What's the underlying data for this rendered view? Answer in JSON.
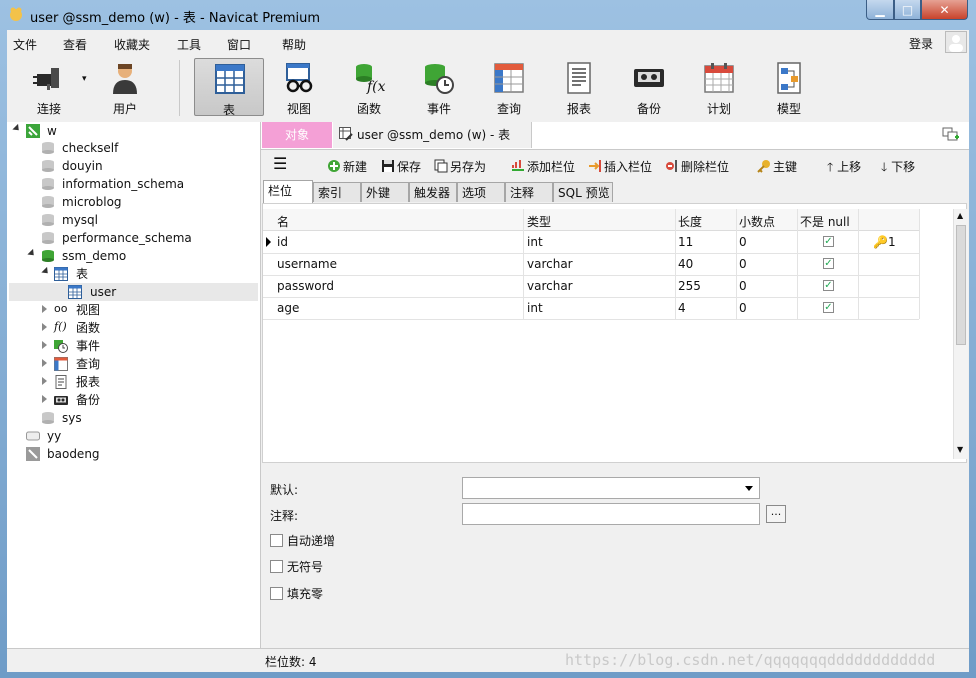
{
  "window": {
    "title": "user @ssm_demo (w) - 表 - Navicat Premium"
  },
  "menu": {
    "items": [
      "文件",
      "查看",
      "收藏夹",
      "工具",
      "窗口",
      "帮助"
    ],
    "login": "登录"
  },
  "toolbar": {
    "items": [
      {
        "label": "连接",
        "icon": "plug-icon"
      },
      {
        "label": "用户",
        "icon": "user-icon"
      },
      {
        "label": "表",
        "icon": "table-icon"
      },
      {
        "label": "视图",
        "icon": "view-glasses-icon"
      },
      {
        "label": "函数",
        "icon": "function-icon"
      },
      {
        "label": "事件",
        "icon": "event-clock-icon"
      },
      {
        "label": "查询",
        "icon": "query-icon"
      },
      {
        "label": "报表",
        "icon": "report-icon"
      },
      {
        "label": "备份",
        "icon": "backup-tape-icon"
      },
      {
        "label": "计划",
        "icon": "calendar-icon"
      },
      {
        "label": "模型",
        "icon": "model-icon"
      }
    ]
  },
  "nav": {
    "connection": "w",
    "databases": [
      "checkself",
      "douyin",
      "information_schema",
      "microblog",
      "mysql",
      "performance_schema",
      "ssm_demo"
    ],
    "ssm_demo": {
      "tables_label": "表",
      "table_user": "user",
      "others": [
        "视图",
        "函数",
        "事件",
        "查询",
        "报表",
        "备份"
      ]
    },
    "sys": "sys",
    "other_connections": [
      "yy",
      "baodeng"
    ]
  },
  "tabs": {
    "object": "对象",
    "doc": "user @ssm_demo (w) - 表"
  },
  "actions": {
    "new": "新建",
    "save": "保存",
    "save_as": "另存为",
    "add_field": "添加栏位",
    "insert_field": "插入栏位",
    "delete_field": "删除栏位",
    "primary_key": "主键",
    "move_up": "上移",
    "move_down": "下移"
  },
  "subtabs": [
    "栏位",
    "索引",
    "外键",
    "触发器",
    "选项",
    "注释",
    "SQL 预览"
  ],
  "grid": {
    "columns": [
      "名",
      "类型",
      "长度",
      "小数点",
      "不是 null"
    ],
    "rows": [
      {
        "name": "id",
        "type": "int",
        "length": "11",
        "decimals": "0",
        "not_null": true,
        "key": "1"
      },
      {
        "name": "username",
        "type": "varchar",
        "length": "40",
        "decimals": "0",
        "not_null": true,
        "key": ""
      },
      {
        "name": "password",
        "type": "varchar",
        "length": "255",
        "decimals": "0",
        "not_null": true,
        "key": ""
      },
      {
        "name": "age",
        "type": "int",
        "length": "4",
        "decimals": "0",
        "not_null": true,
        "key": ""
      }
    ]
  },
  "props": {
    "default_label": "默认:",
    "comment_label": "注释:",
    "ellipsis": "...",
    "checks": [
      "自动递增",
      "无符号",
      "填充零"
    ]
  },
  "status": {
    "text": "栏位数: 4",
    "watermark": "https://blog.csdn.net/qqqqqqqdddddddddddd"
  },
  "colors": {
    "object_tab": "#f4a0d6",
    "title_bg": "#9dc1e2",
    "close_btn": "#c9432b"
  }
}
